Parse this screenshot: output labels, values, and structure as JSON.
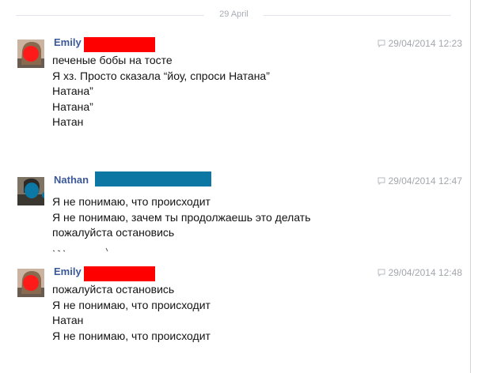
{
  "date_separator": "29 April",
  "colors": {
    "author_link": "#3b5998",
    "redaction_red": "#ff0000",
    "redaction_blue": "#0b77a2",
    "timestamp_gray": "#a3a7ad"
  },
  "messages": [
    {
      "author": "Emily",
      "timestamp": "29/04/2014 12:23",
      "timestamp_icon": "chat-bubble-icon",
      "lines": [
        "печеные бобы на тосте",
        "Я хз. Просто сказала “йоу, спроси Натана”",
        "Натана”",
        "Натана”",
        "Натан"
      ]
    },
    {
      "author": "Nathan",
      "timestamp": "29/04/2014 12:47",
      "timestamp_icon": "chat-bubble-icon",
      "lines": [
        "Я не понимаю, что происходит",
        "Я не понимаю, зачем ты продолжаешь это делать",
        "пожалуйста остановись"
      ]
    },
    {
      "author": "Emily",
      "timestamp": "29/04/2014 12:48",
      "timestamp_icon": "chat-bubble-icon",
      "lines": [
        "пожалуйста остановись",
        "Я не понимаю, что происходит",
        "Натан",
        "Я не понимаю, что происходит"
      ]
    }
  ]
}
